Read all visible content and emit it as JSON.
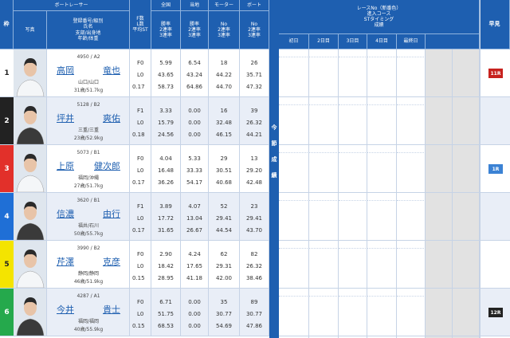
{
  "header": {
    "boat_racer": "ボートレーサー",
    "waku": "枠",
    "photo": "写真",
    "reg_lines": [
      "登録番号/級別",
      "氏名",
      "支部/出身地",
      "年齢/体重"
    ],
    "f_lines": [
      "F数",
      "L数",
      "平均ST"
    ],
    "zenkoku": "全国",
    "tochi": "当地",
    "motor": "モーター",
    "boat": "ボート",
    "rate_lines": [
      "勝率",
      "2連率",
      "3連率"
    ],
    "motor_lines": [
      "No",
      "2連率",
      "3連率"
    ],
    "race_lines": [
      "レースNo（新番色）",
      "進入コース",
      "STタイミング",
      "成績"
    ],
    "days": [
      "初日",
      "2日目",
      "3日目",
      "4日目",
      "最終日"
    ],
    "hayami": "早見",
    "konsetsu": [
      "今",
      "節",
      "成",
      "績"
    ]
  },
  "colors": {
    "header_blue": "#1e5fb0",
    "waku": [
      "#ffffff",
      "#222222",
      "#e2302a",
      "#1f6fd6",
      "#f4e400",
      "#25a94c"
    ]
  },
  "racers": [
    {
      "waku": "1",
      "reg": "4950 / A2",
      "family": "高岡",
      "given": "竜也",
      "branch": "山口/山口",
      "age": "31歳/51.7kg",
      "f": "F0",
      "l": "L0",
      "st": "0.17",
      "zk": [
        "5.99",
        "43.65",
        "58.73"
      ],
      "tc": [
        "6.54",
        "43.24",
        "64.86"
      ],
      "motor": [
        "18",
        "44.22",
        "44.70"
      ],
      "boat": [
        "26",
        "35.71",
        "47.32"
      ],
      "hayami": "11R",
      "hayami_color": "#c7221e"
    },
    {
      "waku": "2",
      "reg": "5128 / B2",
      "family": "坪井",
      "given": "爽佑",
      "branch": "三重/三重",
      "age": "23歳/52.9kg",
      "f": "F1",
      "l": "L0",
      "st": "0.18",
      "zk": [
        "3.33",
        "15.79",
        "24.56"
      ],
      "tc": [
        "0.00",
        "0.00",
        "0.00"
      ],
      "motor": [
        "16",
        "32.48",
        "46.15"
      ],
      "boat": [
        "39",
        "26.32",
        "44.21"
      ],
      "hayami": "",
      "hayami_color": ""
    },
    {
      "waku": "3",
      "reg": "5073 / B1",
      "family": "上原",
      "given": "健次郎",
      "branch": "福岡/沖縄",
      "age": "27歳/51.7kg",
      "f": "F0",
      "l": "L0",
      "st": "0.17",
      "zk": [
        "4.04",
        "16.48",
        "36.26"
      ],
      "tc": [
        "5.33",
        "33.33",
        "54.17"
      ],
      "motor": [
        "29",
        "30.51",
        "40.68"
      ],
      "boat": [
        "13",
        "29.20",
        "42.48"
      ],
      "hayami": "1R",
      "hayami_color": "#3b82d4"
    },
    {
      "waku": "4",
      "reg": "3620 / B1",
      "family": "信濃",
      "given": "由行",
      "branch": "福井/石川",
      "age": "50歳/55.7kg",
      "f": "F1",
      "l": "L0",
      "st": "0.17",
      "zk": [
        "3.89",
        "17.72",
        "31.65"
      ],
      "tc": [
        "4.07",
        "13.04",
        "26.67"
      ],
      "motor": [
        "52",
        "29.41",
        "44.54"
      ],
      "boat": [
        "23",
        "29.41",
        "43.70"
      ],
      "hayami": "",
      "hayami_color": ""
    },
    {
      "waku": "5",
      "reg": "3990 / B2",
      "family": "芹澤",
      "given": "克彦",
      "branch": "静岡/静岡",
      "age": "46歳/51.9kg",
      "f": "F0",
      "l": "L0",
      "st": "0.15",
      "zk": [
        "2.90",
        "18.42",
        "28.95"
      ],
      "tc": [
        "4.24",
        "17.65",
        "41.18"
      ],
      "motor": [
        "62",
        "29.31",
        "42.00"
      ],
      "boat": [
        "82",
        "26.32",
        "38.46"
      ],
      "hayami": "",
      "hayami_color": ""
    },
    {
      "waku": "6",
      "reg": "4287 / A1",
      "family": "今井",
      "given": "貴士",
      "branch": "福岡/福岡",
      "age": "40歳/55.9kg",
      "f": "F0",
      "l": "L0",
      "st": "0.15",
      "zk": [
        "6.71",
        "51.75",
        "68.53"
      ],
      "tc": [
        "0.00",
        "0.00",
        "0.00"
      ],
      "motor": [
        "35",
        "30.77",
        "54.69"
      ],
      "boat": [
        "89",
        "30.77",
        "47.86"
      ],
      "hayami": "12R",
      "hayami_color": "#222222"
    }
  ]
}
